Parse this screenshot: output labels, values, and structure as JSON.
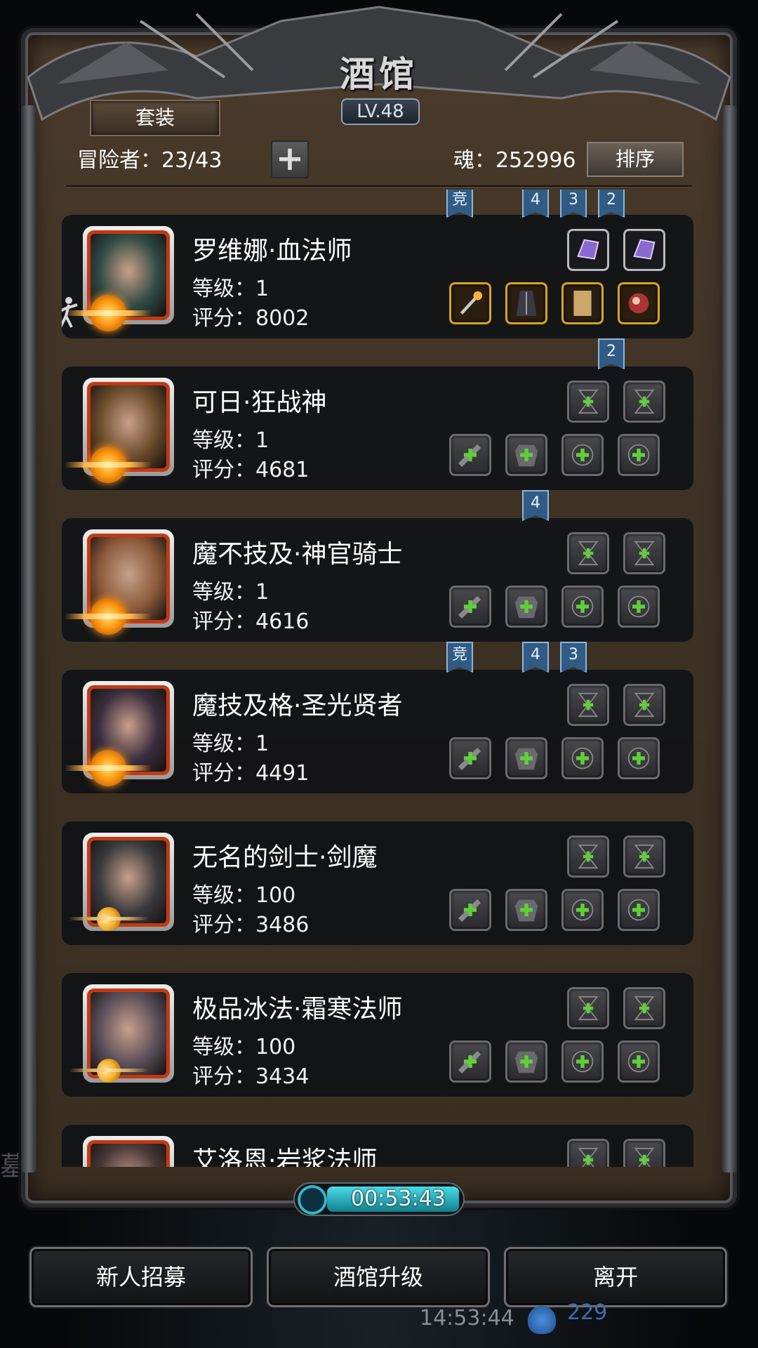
{
  "title": "酒馆",
  "level": "LV.48",
  "tab_button": "套装",
  "adventurers": "冒险者：23/43",
  "souls": "魂：252996",
  "sort_button": "排序",
  "heroes": [
    {
      "name": "罗维娜·血法师",
      "level": "等级：1",
      "score": "评分：8002",
      "emblem": "star",
      "face": "#2f4a44",
      "badges": [
        "竞",
        "4",
        "3",
        "2"
      ]
    },
    {
      "name": "可日·狂战神",
      "level": "等级：1",
      "score": "评分：4681",
      "emblem": "star",
      "face": "#6a4a2a",
      "badges": [
        "2"
      ]
    },
    {
      "name": "魔不技及·神官骑士",
      "level": "等级：1",
      "score": "评分：4616",
      "emblem": "star",
      "face": "#8a5a3a",
      "badges": [
        "4"
      ]
    },
    {
      "name": "魔技及格·圣光贤者",
      "level": "等级：1",
      "score": "评分：4491",
      "emblem": "star",
      "face": "#3a2e3e",
      "badges": [
        "竞",
        "4",
        "3"
      ]
    },
    {
      "name": "无名的剑士·剑魔",
      "level": "等级：100",
      "score": "评分：3486",
      "emblem": "moon",
      "face": "#3a3a3e",
      "badges": []
    },
    {
      "name": "极品冰法·霜寒法师",
      "level": "等级：100",
      "score": "评分：3434",
      "emblem": "moon",
      "face": "#5a4e5a",
      "badges": []
    },
    {
      "name": "艾洛恩·岩浆法师",
      "level": "",
      "score": "",
      "emblem": "moon",
      "face": "#4a3a3a",
      "badges": []
    }
  ],
  "timer": "00:53:43",
  "bottom_buttons": [
    "新人招募",
    "酒馆升级",
    "离开"
  ],
  "status_bar": {
    "time": "14:53:44",
    "count": "229"
  },
  "left_edge_text": "墓",
  "colors": {
    "card_bg": "#101216",
    "badge_blue": "#2f5b85",
    "gold_slot": "#d7a41a",
    "portrait_red": "#c33a12",
    "timer_cyan": "#4adbe8"
  }
}
